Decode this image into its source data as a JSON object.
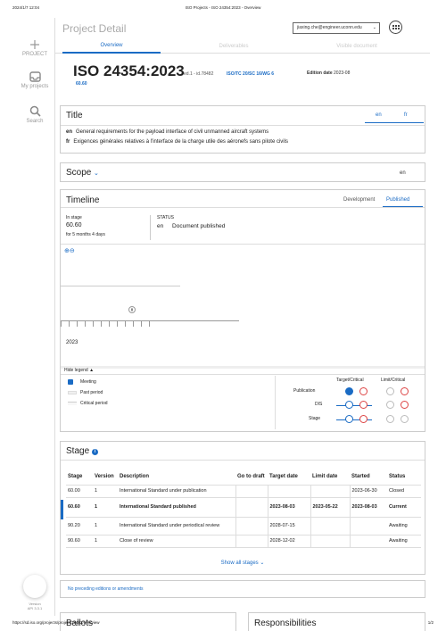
{
  "print": {
    "date": "2024/1/7 12:04",
    "title": "ISO Projects - ISO 24354:2023 - Overview",
    "url": "https://sd.iso.org/projects/project/78482/overview",
    "page": "1/2"
  },
  "sidebar": {
    "items": [
      {
        "label": "PROJECT",
        "icon": "plus-icon"
      },
      {
        "label": "My projects",
        "icon": "inbox-icon"
      },
      {
        "label": "Search",
        "icon": "search-icon"
      }
    ],
    "version_label": "Version",
    "version_value": "API 3.3.1"
  },
  "topbar": {
    "page_title": "Project Detail",
    "user_email": "jiaxing.che@engineer.uconn.edu",
    "user_caret": "⌄"
  },
  "tabs": [
    {
      "label": "Overview",
      "active": true
    },
    {
      "label": "Deliverables",
      "active": false
    },
    {
      "label": "Visible document",
      "active": false
    }
  ],
  "standard": {
    "title": "ISO 24354:2023",
    "edition": "ed.1 - id.78482",
    "committee": "ISO/TC 20/SC 16/WG 6",
    "edition_date_label": "Edition date",
    "edition_date": "2023-08",
    "stage": "60.60"
  },
  "title_panel": {
    "heading": "Title",
    "tabs": [
      "en",
      "fr"
    ],
    "lines": [
      {
        "lang": "en",
        "text": "General requirements for the payload interface of civil unmanned aircraft systems"
      },
      {
        "lang": "fr",
        "text": "Exigences générales relatives à l'interface de la charge utile des aéronefs sans pilote civils"
      }
    ]
  },
  "scope_panel": {
    "heading": "Scope",
    "chevron": "⌄",
    "lang": "en"
  },
  "timeline": {
    "heading": "Timeline",
    "tabs": {
      "development": "Development",
      "published": "Published"
    },
    "in_stage_label": "In stage",
    "in_stage_value": "60.60",
    "in_stage_duration": "for 5 months 4 days",
    "status_label": "STATUS",
    "status_lang": "en",
    "status_value": "Document published",
    "zoom_icons": "⊕⊖",
    "year": "2023",
    "legend_toggle": "Hide legend ▲",
    "legend": [
      {
        "label": "Meeting",
        "color": "#1a6bc4"
      },
      {
        "label": "Past period",
        "color": "#f0f0f0"
      },
      {
        "label": "Critical period",
        "color": "#f8f8f8"
      }
    ],
    "legend_table": {
      "head_target": "Target/Critical",
      "head_limit": "Limit/Critical",
      "rows": [
        "Publication",
        "DIS",
        "Stage"
      ]
    }
  },
  "stage_panel": {
    "heading": "Stage",
    "info": "i",
    "columns": [
      "Stage",
      "Version",
      "Description",
      "Go to draft",
      "Target date",
      "Limit date",
      "Started",
      "Status"
    ],
    "rows": [
      {
        "stage": "60.00",
        "version": "1",
        "description": "International Standard under publication",
        "go_to_draft": "",
        "target": "",
        "limit": "",
        "started": "2023-06-30",
        "status": "Closed"
      },
      {
        "stage": "60.60",
        "version": "1",
        "description": "International Standard published",
        "go_to_draft": "",
        "target": "2023-08-03",
        "limit": "2023-05-22",
        "started": "2023-08-03",
        "status": "Current"
      },
      {
        "stage": "90.20",
        "version": "1",
        "description": "International Standard under periodical review",
        "go_to_draft": "",
        "target": "2028-07-15",
        "limit": "",
        "started": "",
        "status": "Awaiting"
      },
      {
        "stage": "90.60",
        "version": "1",
        "description": "Close of review",
        "go_to_draft": "",
        "target": "2028-12-02",
        "limit": "",
        "started": "",
        "status": "Awaiting"
      }
    ],
    "show_all": "Show all stages ⌄"
  },
  "no_prev": "No preceding editions or amendments",
  "ballots_heading": "Ballots",
  "responsibilities_heading": "Responsibilities"
}
